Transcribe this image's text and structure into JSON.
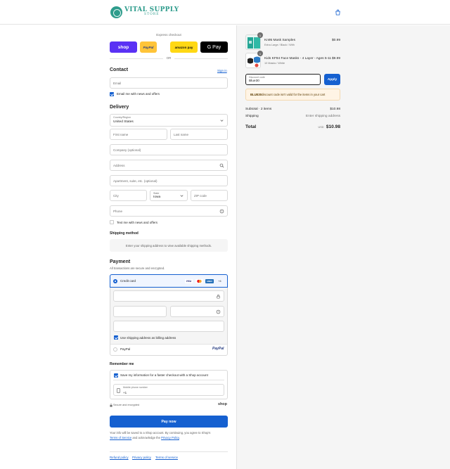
{
  "brand": {
    "line1": "VITAL SUPPLY",
    "line2": "STORE"
  },
  "express": {
    "label": "Express checkout",
    "buttons": {
      "shop": "shop",
      "paypal": "PayPal",
      "amazon": "amazon pay",
      "gpay": "G Pay"
    },
    "or": "OR"
  },
  "contact": {
    "title": "Contact",
    "sign_in": "Sign in",
    "email_placeholder": "Email",
    "email_news": "Email me with news and offers"
  },
  "delivery": {
    "title": "Delivery",
    "country_label": "Country/Region",
    "country_value": "United States",
    "first_name": "First name",
    "last_name": "Last name",
    "company": "Company (optional)",
    "address": "Address",
    "apartment": "Apartment, suite, etc. (optional)",
    "city": "City",
    "state_label": "State",
    "state_value": "Iowa",
    "zip": "ZIP code",
    "phone": "Phone",
    "text_news": "Text me with news and offers"
  },
  "shipping_method": {
    "title": "Shipping method",
    "notice": "Enter your shipping address to view available shipping methods."
  },
  "payment": {
    "title": "Payment",
    "subtitle": "All transactions are secure and encrypted.",
    "credit_card": "Credit card",
    "brands": {
      "visa": "VISA",
      "amex": "AMEX",
      "more": "+4"
    },
    "billing_same": "Use shipping address as billing address",
    "paypal": "PayPal",
    "paypal_logo": "PayPal"
  },
  "remember": {
    "title": "Remember me",
    "save_info": "Save my information for a faster checkout with a Shop account",
    "mobile_label": "Mobile phone number",
    "mobile_value": "+1",
    "secure": "Secure and encrypted",
    "shop_logo": "shop"
  },
  "pay_now": "Pay now",
  "legal": {
    "text1": "Your info will be saved to a Shop account. By continuing, you agree to Shop's",
    "tos": "Terms of Service",
    "and": " and acknowledge the ",
    "privacy": "Privacy Policy",
    "end": "."
  },
  "footer": {
    "refund": "Refund policy",
    "privacy": "Privacy policy",
    "terms": "Terms of service"
  },
  "cart": {
    "items": [
      {
        "name": "Kn95 Mask Samples",
        "variant": "Extra Large / Black / With",
        "price": "$0.99",
        "qty": "1"
      },
      {
        "name": "Kids KF94 Face Masks - 4 Layer - Ages 5-11",
        "variant": "10 Masks / White",
        "price": "$9.99",
        "qty": "1"
      }
    ],
    "discount_label": "Discount code",
    "discount_value": "Blue30",
    "apply": "Apply",
    "warning_code": "BLUE30",
    "warning_text": " discount code isn't valid for the items in your cart",
    "subtotal_label": "Subtotal · 2 items",
    "subtotal_value": "$10.98",
    "shipping_label": "Shipping",
    "shipping_value": "Enter shipping address",
    "total_label": "Total",
    "currency": "USD",
    "total_value": "$10.98"
  },
  "colors": {
    "accent": "#1560d0",
    "brand": "#2e9c8c",
    "shop": "#5a31f4",
    "paypal": "#ffc439",
    "amazon": "#ffd814"
  }
}
